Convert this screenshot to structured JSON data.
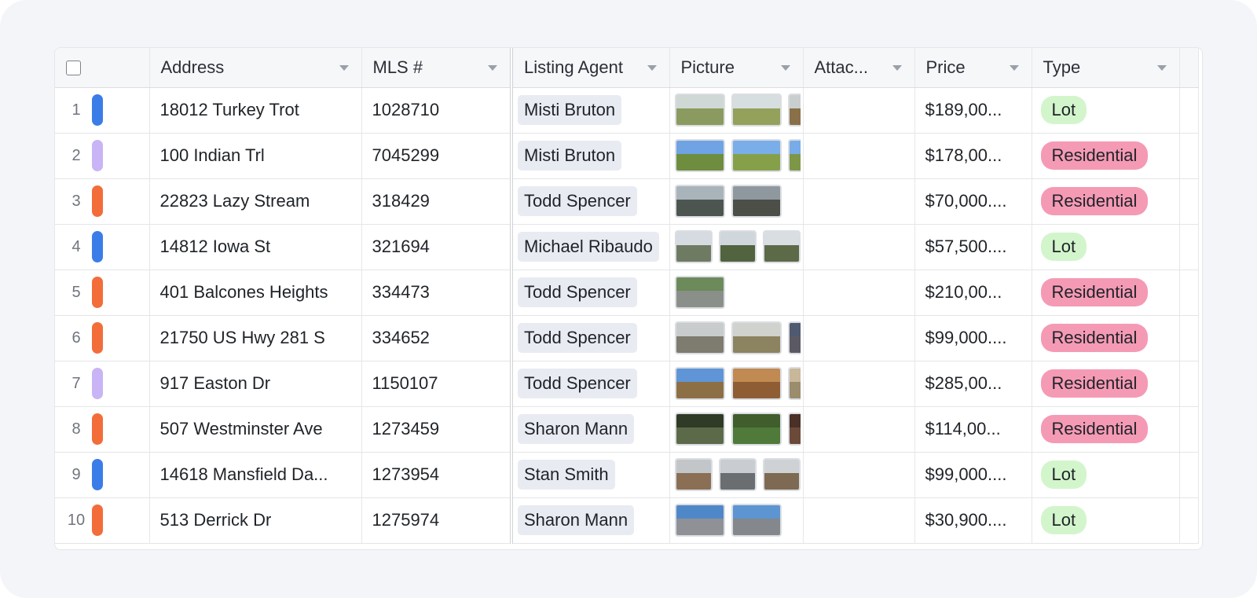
{
  "columns": {
    "address": "Address",
    "mls": "MLS #",
    "agent": "Listing Agent",
    "picture": "Picture",
    "attachments": "Attac...",
    "price": "Price",
    "type": "Type"
  },
  "colors": {
    "blue": "#3b7de8",
    "purple": "#c9b4f5",
    "orange": "#f26d3a",
    "lot_tag": "#d3f5cc",
    "residential_tag": "#f59ab5"
  },
  "rows": [
    {
      "num": "1",
      "color": "#3b7de8",
      "address": "18012 Turkey Trot",
      "mls": "1028710",
      "agent": "Misti Bruton",
      "price": "$189,00...",
      "type": "Lot",
      "type_color": "#d3f5cc",
      "pictures": [
        {
          "sky": "#cfd8d4",
          "ground": "#8b9a5e",
          "w": "wide"
        },
        {
          "sky": "#d6dee0",
          "ground": "#93a15b",
          "w": "wide"
        },
        {
          "sky": "#c9cfcf",
          "ground": "#8a7048",
          "w": "wide"
        }
      ]
    },
    {
      "num": "2",
      "color": "#c9b4f5",
      "address": "100 Indian Trl",
      "mls": "7045299",
      "agent": "Misti Bruton",
      "price": "$178,00...",
      "type": "Residential",
      "type_color": "#f59ab5",
      "pictures": [
        {
          "sky": "#6fa3e3",
          "ground": "#6f8d3f",
          "w": "wide"
        },
        {
          "sky": "#79aee8",
          "ground": "#86a04a",
          "w": "wide"
        },
        {
          "sky": "#78ace9",
          "ground": "#7e9746",
          "w": "wide"
        }
      ]
    },
    {
      "num": "3",
      "color": "#f26d3a",
      "address": "22823 Lazy Stream",
      "mls": "318429",
      "agent": "Todd Spencer",
      "price": "$70,000....",
      "type": "Residential",
      "type_color": "#f59ab5",
      "pictures": [
        {
          "sky": "#a9b3ba",
          "ground": "#4d5550",
          "w": "wide"
        },
        {
          "sky": "#8f989e",
          "ground": "#4c4f48",
          "w": "wide"
        }
      ]
    },
    {
      "num": "4",
      "color": "#3b7de8",
      "address": "14812 Iowa St",
      "mls": "321694",
      "agent": "Michael Ribaudo",
      "price": "$57,500....",
      "type": "Lot",
      "type_color": "#d3f5cc",
      "pictures": [
        {
          "sky": "#d5dbe0",
          "ground": "#6f7a63",
          "w": "sq"
        },
        {
          "sky": "#cfd6dc",
          "ground": "#52633f",
          "w": "sq"
        },
        {
          "sky": "#d9dee2",
          "ground": "#5d6a48",
          "w": "sq"
        }
      ]
    },
    {
      "num": "5",
      "color": "#f26d3a",
      "address": "401 Balcones Heights",
      "mls": "334473",
      "agent": "Todd Spencer",
      "price": "$210,00...",
      "type": "Residential",
      "type_color": "#f59ab5",
      "pictures": [
        {
          "sky": "#6c8a5a",
          "ground": "#8a8f8a",
          "w": "wide"
        }
      ]
    },
    {
      "num": "6",
      "color": "#f26d3a",
      "address": "21750 US Hwy 281 S",
      "mls": "334652",
      "agent": "Todd Spencer",
      "price": "$99,000....",
      "type": "Residential",
      "type_color": "#f59ab5",
      "pictures": [
        {
          "sky": "#c9cccc",
          "ground": "#7e7b6f",
          "w": "wide"
        },
        {
          "sky": "#cfd2cd",
          "ground": "#8c8360",
          "w": "wide"
        },
        {
          "sky": "#4f5a70",
          "ground": "#5b5a63",
          "w": "wide"
        }
      ]
    },
    {
      "num": "7",
      "color": "#c9b4f5",
      "address": "917 Easton Dr",
      "mls": "1150107",
      "agent": "Todd Spencer",
      "price": "$285,00...",
      "type": "Residential",
      "type_color": "#f59ab5",
      "pictures": [
        {
          "sky": "#5f95d6",
          "ground": "#8d6f45",
          "w": "wide"
        },
        {
          "sky": "#c08a52",
          "ground": "#8f5d34",
          "w": "wide"
        },
        {
          "sky": "#c9b79a",
          "ground": "#9b8c6c",
          "w": "wide"
        }
      ]
    },
    {
      "num": "8",
      "color": "#f26d3a",
      "address": "507 Westminster Ave",
      "mls": "1273459",
      "agent": "Sharon Mann",
      "price": "$114,00...",
      "type": "Residential",
      "type_color": "#f59ab5",
      "pictures": [
        {
          "sky": "#2f3b26",
          "ground": "#5c6a4a",
          "w": "wide"
        },
        {
          "sky": "#3f5e2c",
          "ground": "#4f7a3a",
          "w": "wide"
        },
        {
          "sky": "#4a3026",
          "ground": "#6c4a3a",
          "w": "wide"
        }
      ]
    },
    {
      "num": "9",
      "color": "#3b7de8",
      "address": "14618 Mansfield Da...",
      "mls": "1273954",
      "agent": "Stan Smith",
      "price": "$99,000....",
      "type": "Lot",
      "type_color": "#d3f5cc",
      "pictures": [
        {
          "sky": "#c2c6c8",
          "ground": "#8a6f55",
          "w": "sq"
        },
        {
          "sky": "#c9ccd0",
          "ground": "#6b6e70",
          "w": "sq"
        },
        {
          "sky": "#cfd2d4",
          "ground": "#7e6a52",
          "w": "sq"
        }
      ]
    },
    {
      "num": "10",
      "color": "#f26d3a",
      "address": "513 Derrick Dr",
      "mls": "1275974",
      "agent": "Sharon Mann",
      "price": "$30,900....",
      "type": "Lot",
      "type_color": "#d3f5cc",
      "pictures": [
        {
          "sky": "#4f88c9",
          "ground": "#8f9196",
          "w": "wide"
        },
        {
          "sky": "#5c95d2",
          "ground": "#84878b",
          "w": "wide"
        }
      ]
    }
  ]
}
